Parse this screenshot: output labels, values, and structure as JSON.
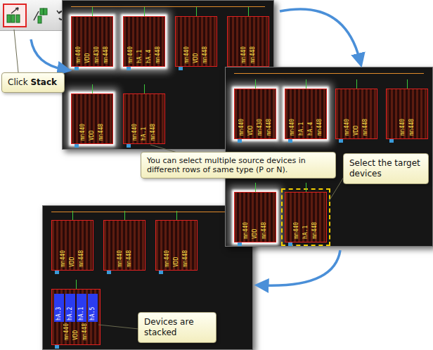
{
  "toolbar": {
    "buttons": [
      {
        "selected": true
      },
      {
        "selected": false
      },
      {
        "selected": false
      }
    ]
  },
  "callouts": {
    "click": {
      "text": "Click ",
      "strong": "Stack"
    },
    "source": {
      "text": "You can select multiple source devices in different rows of same type (P or N)."
    },
    "target": {
      "text": "Select the target devices"
    },
    "result": {
      "text": "Devices are stacked"
    }
  },
  "panels": [
    {
      "rows": [
        [
          {
            "kind": "mos",
            "labels": [
              "mn440",
              "VDD",
              "mn430",
              "mn448"
            ],
            "selected": true,
            "target": false
          },
          {
            "kind": "mos",
            "labels": [
              "mn440",
              "hA.1",
              "hA.4",
              "mn448"
            ],
            "selected": true,
            "target": false
          },
          {
            "kind": "mos",
            "labels": [
              "mn440",
              "VDD",
              "mn448"
            ],
            "selected": false,
            "target": false
          },
          {
            "kind": "mos",
            "labels": [
              "mn440",
              "mn448"
            ],
            "selected": false,
            "target": false
          }
        ],
        [
          {
            "kind": "mos",
            "labels": [
              "mn440",
              "VDD",
              "mn448"
            ],
            "selected": true,
            "target": false
          },
          {
            "kind": "mos",
            "labels": [
              "mn440",
              "hA.1",
              "mn448"
            ],
            "selected": false,
            "target": false
          }
        ]
      ]
    },
    {
      "rows": [
        [
          {
            "kind": "mos",
            "labels": [
              "mn440",
              "VDD",
              "mn430",
              "mn448"
            ],
            "selected": true,
            "target": false
          },
          {
            "kind": "mos",
            "labels": [
              "mn440",
              "hA.1",
              "hA.4",
              "mn448"
            ],
            "selected": true,
            "target": false
          },
          {
            "kind": "mos",
            "labels": [
              "mn440",
              "VDD",
              "mn448"
            ],
            "selected": false,
            "target": false
          },
          {
            "kind": "mos",
            "labels": [
              "mn440",
              "mn448"
            ],
            "selected": false,
            "target": false
          }
        ],
        [
          {
            "kind": "mos",
            "labels": [
              "mn440",
              "VDD",
              "mn448"
            ],
            "selected": true,
            "target": false
          },
          {
            "kind": "mos",
            "labels": [
              "mn440",
              "hA.1",
              "mn448"
            ],
            "selected": false,
            "target": true
          }
        ]
      ]
    },
    {
      "rows": [
        [
          {
            "kind": "mos",
            "labels": [
              "mn440",
              "VDD",
              "mn448"
            ],
            "selected": false,
            "target": false
          },
          {
            "kind": "mos",
            "labels": [
              "mn440",
              "mn448"
            ],
            "selected": false,
            "target": false
          },
          {
            "kind": "mos",
            "labels": [
              "mn440",
              "VDD",
              "mn448"
            ],
            "selected": false,
            "target": false
          }
        ],
        [
          {
            "kind": "stacked",
            "labels": [
              "hA.3",
              "hA.2",
              "hA.1",
              "hA.5"
            ],
            "sub_labels": [
              "mn440",
              "VDD",
              "mn448"
            ],
            "selected": false,
            "target": false
          }
        ]
      ]
    }
  ]
}
